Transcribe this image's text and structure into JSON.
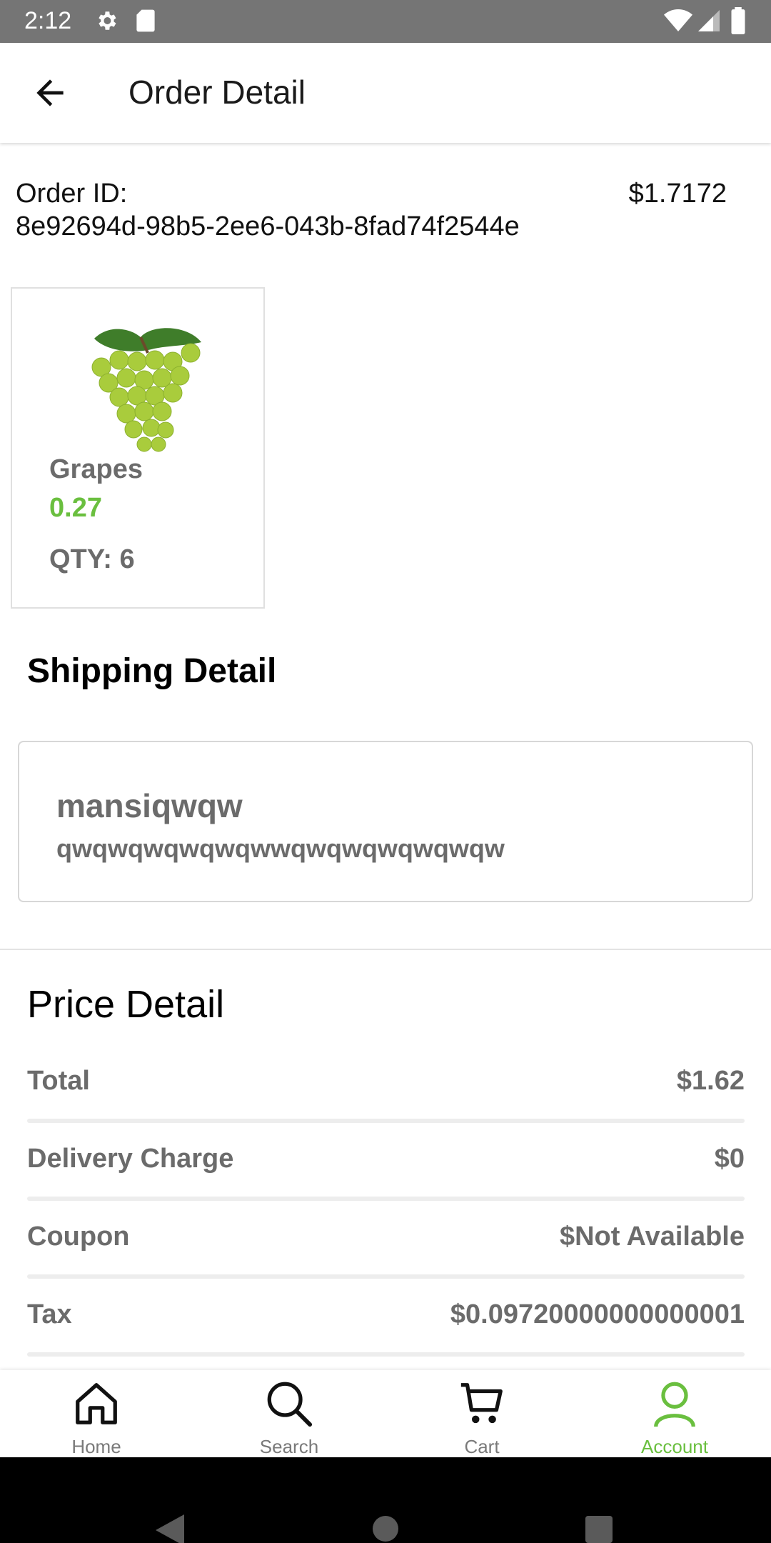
{
  "status_bar": {
    "time": "2:12"
  },
  "app_bar": {
    "title": "Order Detail"
  },
  "order": {
    "id_label": "Order ID:",
    "id_value": "8e92694d-98b5-2ee6-043b-8fad74f2544e",
    "amount": "$1.7172"
  },
  "product": {
    "name": "Grapes",
    "price": "0.27",
    "qty": "QTY: 6"
  },
  "shipping": {
    "title": "Shipping Detail",
    "name": "mansiqwqw",
    "address": "qwqwqwqwqwqwwqwqwqwqwqwqw"
  },
  "price_detail": {
    "title": "Price Detail",
    "rows": [
      {
        "label": "Total",
        "value": "$1.62"
      },
      {
        "label": "Delivery Charge",
        "value": "$0"
      },
      {
        "label": "Coupon",
        "value": "$Not Available"
      },
      {
        "label": "Tax",
        "value": "$0.09720000000000001"
      }
    ]
  },
  "bottom_nav": {
    "items": [
      {
        "label": "Home"
      },
      {
        "label": "Search"
      },
      {
        "label": "Cart"
      },
      {
        "label": "Account"
      }
    ]
  },
  "colors": {
    "accent": "#6abf3f",
    "muted_text": "#6b6b6b",
    "status_bar": "#757575"
  }
}
